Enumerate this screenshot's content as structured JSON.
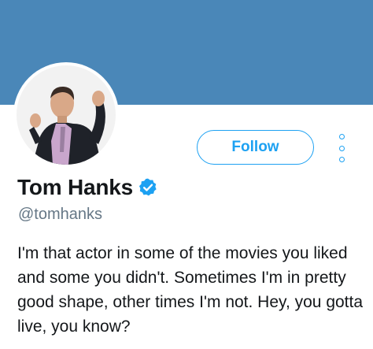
{
  "colors": {
    "banner": "#4a87b8",
    "accent": "#1da1f2",
    "text": "#14171a",
    "secondary_text": "#657786"
  },
  "profile": {
    "display_name": "Tom Hanks",
    "handle": "@tomhanks",
    "verified": true,
    "bio": "I'm that actor in some of the movies you liked and some you didn't. Sometimes I'm in pretty good shape, other times I'm not. Hey, you gotta live, you know?"
  },
  "actions": {
    "follow_label": "Follow",
    "more_icon": "more-vertical-icon"
  }
}
